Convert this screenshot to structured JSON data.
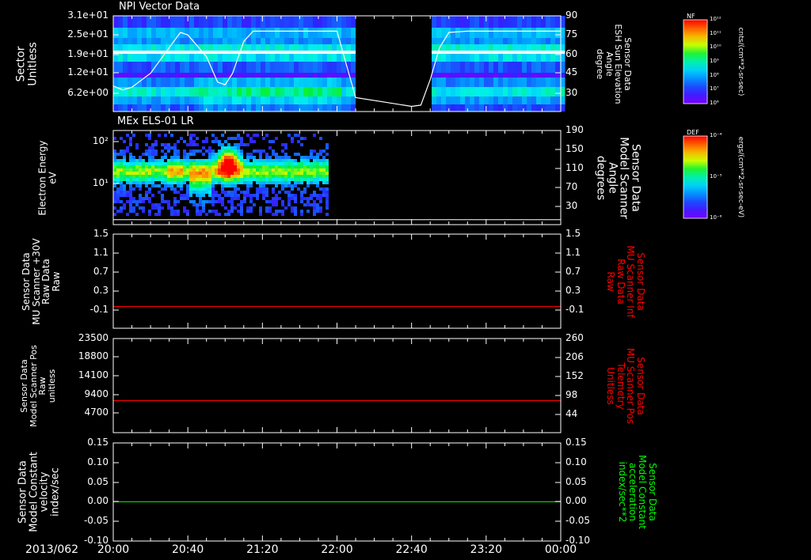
{
  "chart_data": [
    {
      "type": "heatmap",
      "title": "NPI Vector Data",
      "ylabel": "Sector\nUnitless",
      "yticks": [
        "3.1e+01",
        "2.5e+01",
        "1.9e+01",
        "1.2e+01",
        "6.2e+00"
      ],
      "right_ylabel": "Sensor Data\nESH Sun Elevation\nAngle\ndegree",
      "right_yticks": [
        "90",
        "75",
        "60",
        "45",
        "30"
      ],
      "right_ylim": [
        15,
        90
      ],
      "gap": [
        "22:10",
        "22:50"
      ],
      "line_series": {
        "x": [
          "20:00",
          "20:05",
          "20:10",
          "20:20",
          "20:30",
          "20:36",
          "20:40",
          "20:50",
          "20:56",
          "21:00",
          "21:04",
          "21:10",
          "21:15",
          "21:20",
          "21:30",
          "21:40",
          "21:50",
          "22:00",
          "22:10",
          "22:40",
          "22:45",
          "22:50",
          "22:55",
          "23:00",
          "23:10",
          "23:30",
          "23:50",
          "24:00"
        ],
        "values": [
          35,
          32,
          34,
          45,
          65,
          77,
          75,
          58,
          38,
          36,
          45,
          70,
          78,
          78,
          78,
          78,
          78,
          78,
          26,
          19,
          20,
          40,
          65,
          77,
          78,
          78,
          78,
          78
        ]
      },
      "colorbar": {
        "label": "NF",
        "units": "cnts/(cm**2-sr-sec)",
        "ticks": [
          "10^12",
          "10^11",
          "10^10",
          "10^9",
          "10^8",
          "10^7",
          "10^6"
        ]
      }
    },
    {
      "type": "heatmap",
      "title": "MEx ELS-01 LR",
      "ylabel": "Electron Energy\neV",
      "yticks": [
        "10^2",
        "10^1"
      ],
      "right_ylabel": "Sensor Data\nModel Scanner\nAngle\ndegrees",
      "right_yticks": [
        "190",
        "150",
        "110",
        "70",
        "30"
      ],
      "right_ylim": [
        0,
        190
      ],
      "data_end": "21:55",
      "line_series": {
        "x": [
          "20:00",
          "24:00"
        ],
        "values": [
          10,
          10
        ]
      },
      "colorbar": {
        "label": "DEF",
        "units": "ergs/(cm**2-sr-sec-eV)",
        "ticks": [
          "10^-4",
          "10^-5",
          "10^-6"
        ]
      }
    },
    {
      "type": "line",
      "ylabel": "Sensor Data\nMU Scanner +30V\nRaw Data\nRaw",
      "yticks": [
        "1.5",
        "1.1",
        "0.7",
        "0.3",
        "-0.1"
      ],
      "ylim": [
        -0.45,
        1.5
      ],
      "right_ylabel": "Sensor Data\nMU Scanner Inf\nRaw Data\nRaw",
      "right_yticks": [
        "1.5",
        "1.1",
        "0.7",
        "0.3",
        "-0.1"
      ],
      "series": [
        {
          "color": "#ff0000",
          "x": [
            "20:00",
            "24:00"
          ],
          "values": [
            0.0,
            0.0
          ]
        }
      ]
    },
    {
      "type": "line",
      "ylabel": "Sensor Data\nModel Scanner Pos\nRaw\nunitless",
      "yticks": [
        "23500",
        "18800",
        "14100",
        "9400",
        "4700"
      ],
      "ylim": [
        0,
        23500
      ],
      "right_ylabel": "Sensor Data\nMU Scanner Pos\nTelemetry\nUnitless",
      "right_yticks": [
        "260",
        "206",
        "152",
        "98",
        "44"
      ],
      "right_ylim": [
        0,
        260
      ],
      "series": [
        {
          "color": "#ff0000",
          "x": [
            "20:00",
            "24:00"
          ],
          "values": [
            8000,
            8000
          ]
        }
      ]
    },
    {
      "type": "line",
      "ylabel": "Sensor Data\nModel Constant\nvelocity\nindex/sec",
      "yticks": [
        "0.15",
        "0.10",
        "0.05",
        "0.00",
        "-0.05",
        "-0.10"
      ],
      "ylim": [
        -0.1,
        0.15
      ],
      "right_ylabel": "Sensor Data\nModel Constant\nacceleration\nindex/sec**2",
      "right_yticks": [
        "0.15",
        "0.10",
        "0.05",
        "0.00",
        "-0.05",
        "-0.10"
      ],
      "series": [
        {
          "color": "#00ff00",
          "x": [
            "20:00",
            "24:00"
          ],
          "values": [
            0.0,
            0.0
          ]
        }
      ]
    }
  ],
  "xaxis": {
    "date_label": "2013/062",
    "ticks": [
      "20:00",
      "20:40",
      "21:20",
      "22:00",
      "22:40",
      "23:20",
      "00:00"
    ],
    "range": [
      "20:00",
      "24:00"
    ]
  },
  "colors": {
    "background": "#000000",
    "axis": "#ffffff",
    "red_label": "#ff0000",
    "green_label": "#00ff00"
  }
}
